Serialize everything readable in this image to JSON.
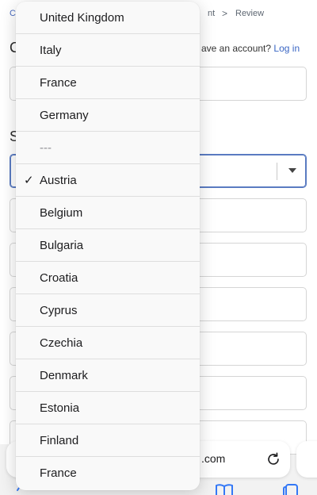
{
  "breadcrumbs": {
    "first": "C",
    "current": "nt",
    "separator": ">",
    "last": "Review"
  },
  "sections": {
    "contact_letter": "C",
    "shipping_letter": "S"
  },
  "login": {
    "prompt": "ave an account?",
    "link": "Log in"
  },
  "browser": {
    "address_text": ".com"
  },
  "menu": {
    "selected": "Austria",
    "check_glyph": "✓",
    "items": [
      "United Kingdom",
      "Italy",
      "France",
      "Germany",
      "---",
      "Austria",
      "Belgium",
      "Bulgaria",
      "Croatia",
      "Cyprus",
      "Czechia",
      "Denmark",
      "Estonia",
      "Finland",
      "France"
    ]
  }
}
